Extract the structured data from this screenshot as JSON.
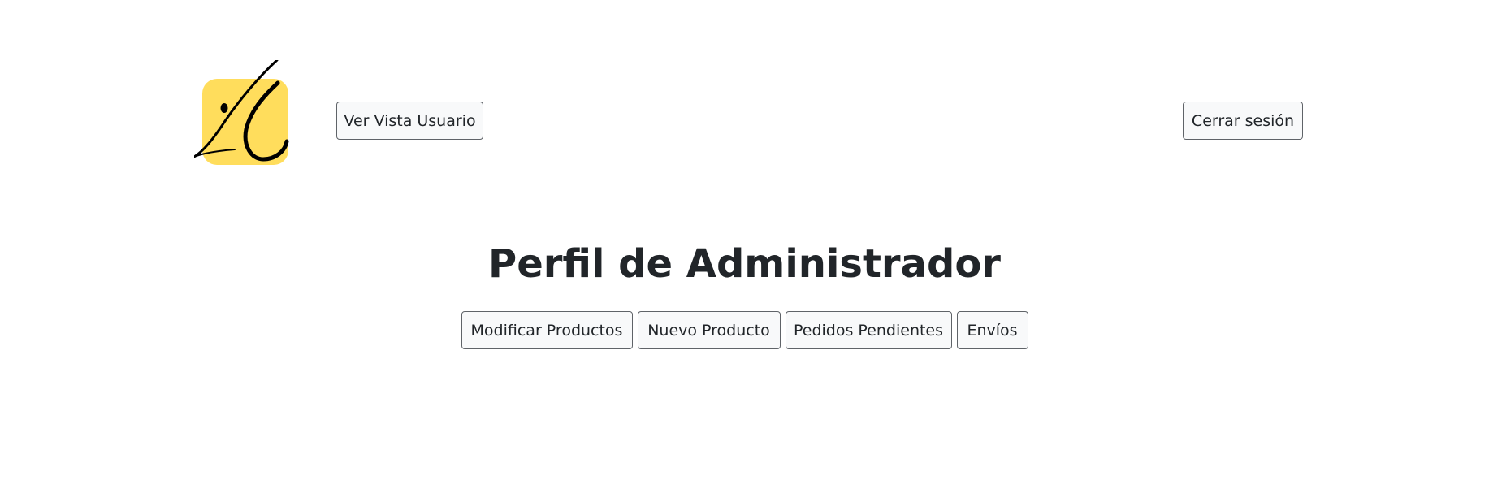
{
  "header": {
    "logo_icon": "brand-logo",
    "logo_color": "#ffdd5c",
    "view_user_label": "Ver Vista Usuario",
    "logout_label": "Cerrar sesión"
  },
  "main": {
    "title": "Perfil de Administrador",
    "actions": [
      {
        "label": "Modificar Productos"
      },
      {
        "label": "Nuevo Producto"
      },
      {
        "label": "Pedidos Pendientes"
      },
      {
        "label": "Envíos"
      }
    ]
  }
}
